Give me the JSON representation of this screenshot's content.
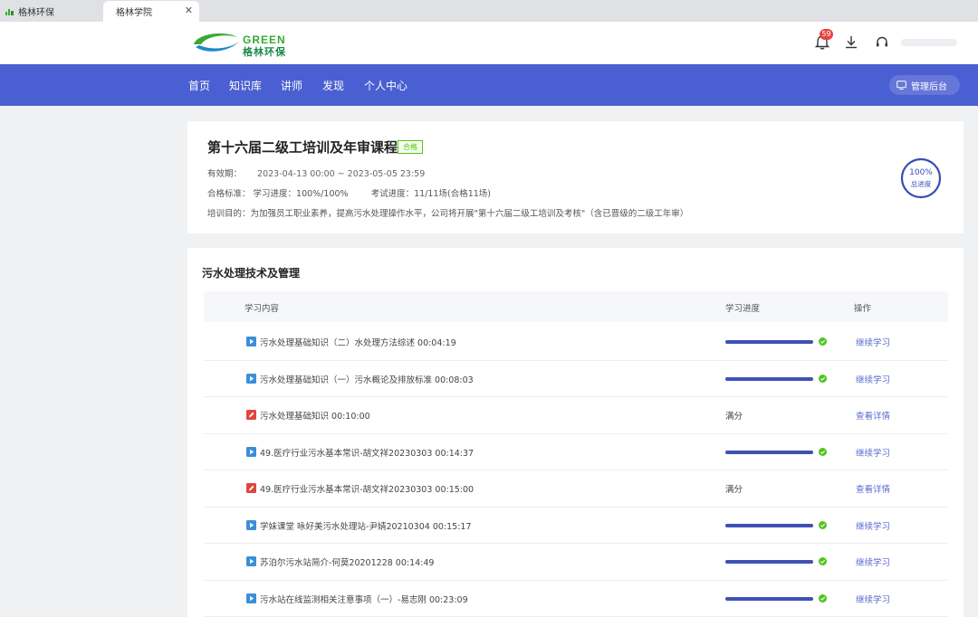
{
  "browser": {
    "tabs": [
      {
        "label": "格林环保",
        "active": false
      },
      {
        "label": "格林学院",
        "active": true
      }
    ]
  },
  "header": {
    "logo": {
      "en": "GREEN",
      "cn": "格林环保"
    },
    "notification_count": "59",
    "icons": [
      "bell-icon",
      "download-icon",
      "headset-icon"
    ]
  },
  "nav": {
    "items": [
      "首页",
      "知识库",
      "讲师",
      "发现",
      "个人中心"
    ],
    "admin_label": "管理后台"
  },
  "course": {
    "title": "第十六届二级工培训及年审课程",
    "status_tag": "合格",
    "validity_label": "有效期：",
    "validity_value": "2023-04-13 00:00 ~ 2023-05-05 23:59",
    "criteria_label": "合格标准：",
    "study_progress": "学习进度：100%/100%",
    "exam_progress": "考试进度：11/11场(合格11场)",
    "purpose": "培训目的：为加强员工职业素养，提高污水处理操作水平，公司将开展\"第十六届二级工培训及考核\"（含已晋级的二级工年审）",
    "total_progress_pct": "100%",
    "total_progress_label": "总进度",
    "total_progress_value": 100
  },
  "section": {
    "title": "污水处理技术及管理",
    "columns": {
      "content": "学习内容",
      "progress": "学习进度",
      "action": "操作"
    },
    "rows": [
      {
        "type": "video",
        "title": "污水处理基础知识（二）水处理方法综述 00:04:19",
        "progress": 100,
        "status": "",
        "action": "继续学习"
      },
      {
        "type": "video",
        "title": "污水处理基础知识（一）污水概论及排放标准 00:08:03",
        "progress": 100,
        "status": "",
        "action": "继续学习"
      },
      {
        "type": "exam",
        "title": "污水处理基础知识 00:10:00",
        "progress": null,
        "status": "满分",
        "action": "查看详情"
      },
      {
        "type": "video",
        "title": "49.医疗行业污水基本常识-胡文祥20230303 00:14:37",
        "progress": 100,
        "status": "",
        "action": "继续学习"
      },
      {
        "type": "exam",
        "title": "49.医疗行业污水基本常识-胡文祥20230303 00:15:00",
        "progress": null,
        "status": "满分",
        "action": "查看详情"
      },
      {
        "type": "video",
        "title": "学妹课堂 咏好美污水处理站-尹婧20210304 00:15:17",
        "progress": 100,
        "status": "",
        "action": "继续学习"
      },
      {
        "type": "video",
        "title": "苏泊尔污水站简介-何莫20201228 00:14:49",
        "progress": 100,
        "status": "",
        "action": "继续学习"
      },
      {
        "type": "video",
        "title": "污水站在线监测相关注意事项（一）-易志刚 00:23:09",
        "progress": 100,
        "status": "",
        "action": "继续学习"
      }
    ]
  },
  "colors": {
    "nav_blue": "#4a5fd1",
    "progress_blue": "#3f51b5",
    "check_green": "#52c41a",
    "link_blue": "#5b6ad0",
    "video_icon": "#3a8fd9",
    "exam_icon": "#e0463f"
  }
}
